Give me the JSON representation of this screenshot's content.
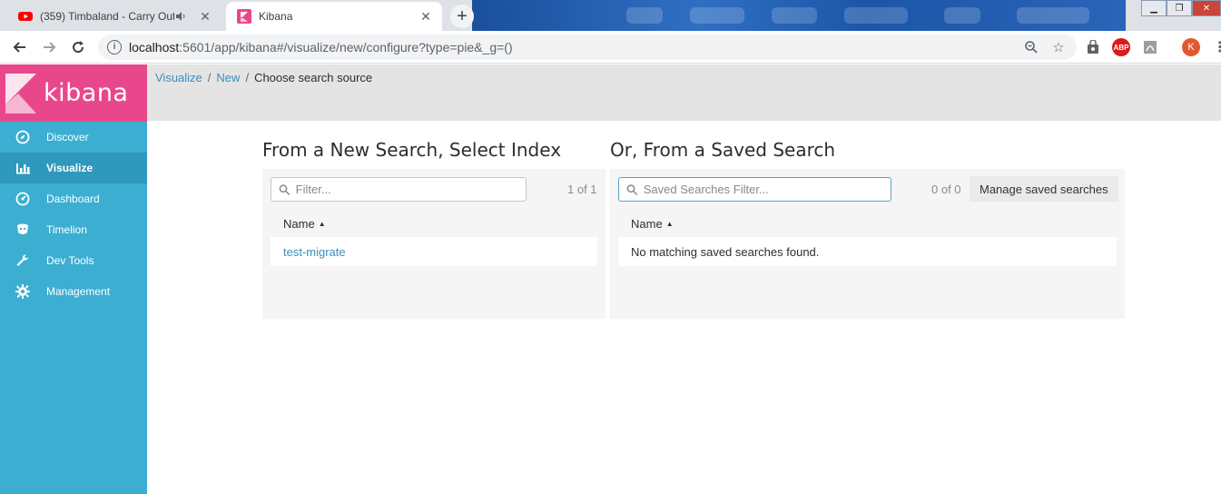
{
  "browser": {
    "tabs": [
      {
        "title": "(359) Timbaland - Carry Out",
        "active": false
      },
      {
        "title": "Kibana",
        "active": true
      }
    ],
    "url_host": "localhost",
    "url_rest": ":5601/app/kibana#/visualize/new/configure?type=pie&_g=()",
    "ext_abp": "ABP",
    "avatar_letter": "K"
  },
  "kibana": {
    "logo_text": "kibana",
    "nav": [
      {
        "label": "Discover",
        "icon": "compass-icon"
      },
      {
        "label": "Visualize",
        "icon": "bar-chart-icon",
        "selected": true
      },
      {
        "label": "Dashboard",
        "icon": "dashboard-icon"
      },
      {
        "label": "Timelion",
        "icon": "timelion-icon"
      },
      {
        "label": "Dev Tools",
        "icon": "wrench-icon"
      },
      {
        "label": "Management",
        "icon": "gear-icon"
      }
    ]
  },
  "breadcrumb": {
    "items": [
      "Visualize",
      "New",
      "Choose search source"
    ],
    "separator": "/"
  },
  "index_panel": {
    "title": "From a New Search, Select Index",
    "filter_placeholder": "Filter...",
    "count": "1 of 1",
    "column": "Name",
    "rows": [
      "test-migrate"
    ]
  },
  "saved_panel": {
    "title": "Or, From a Saved Search",
    "filter_placeholder": "Saved Searches Filter...",
    "count": "0 of 0",
    "manage_label": "Manage saved searches",
    "column": "Name",
    "empty_message": "No matching saved searches found."
  },
  "colors": {
    "sidebar": "#3caed2",
    "logo_bg": "#e8488b",
    "link": "#3b8ec2"
  }
}
